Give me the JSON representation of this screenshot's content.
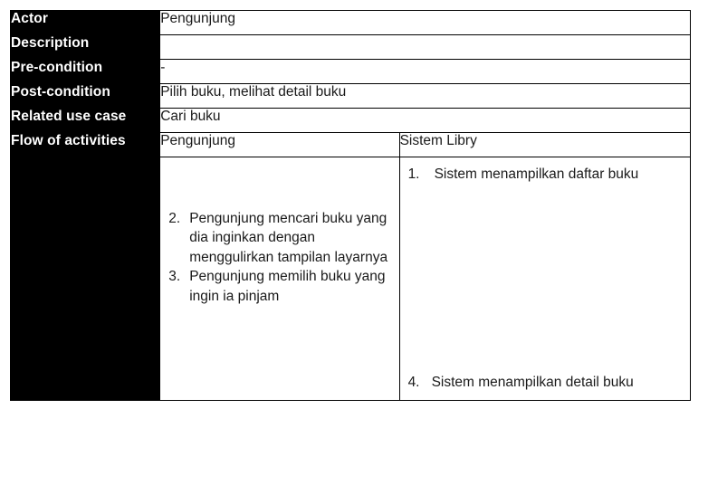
{
  "table": {
    "rows": [
      {
        "label": "Actor",
        "value": "Pengunjung"
      },
      {
        "label": "Description",
        "value": ""
      },
      {
        "label": "Pre-condition",
        "value": "-"
      },
      {
        "label": "Post-condition",
        "value": "Pilih buku, melihat detail buku"
      },
      {
        "label": "Related use case",
        "value": "Cari buku"
      }
    ],
    "flow": {
      "label": "Flow of activities",
      "actor_column_header": "Pengunjung",
      "system_column_header": "Sistem Libry",
      "actor_steps": [
        {
          "num": "2.",
          "text": "Pengunjung mencari buku yang dia inginkan dengan menggulirkan tampilan layarnya"
        },
        {
          "num": "3.",
          "text": "Pengunjung memilih buku yang ingin ia pinjam"
        }
      ],
      "system_steps_top": [
        {
          "num": "1.",
          "text": "Sistem menampilkan daftar buku"
        }
      ],
      "system_steps_bottom": [
        {
          "num": "4.",
          "text": "Sistem menampilkan detail buku"
        }
      ]
    }
  },
  "colors": {
    "label_background": "#000000",
    "label_text": "#ffffff",
    "body_text": "#1a1a1a",
    "border": "#000000",
    "page_background": "#ffffff"
  }
}
